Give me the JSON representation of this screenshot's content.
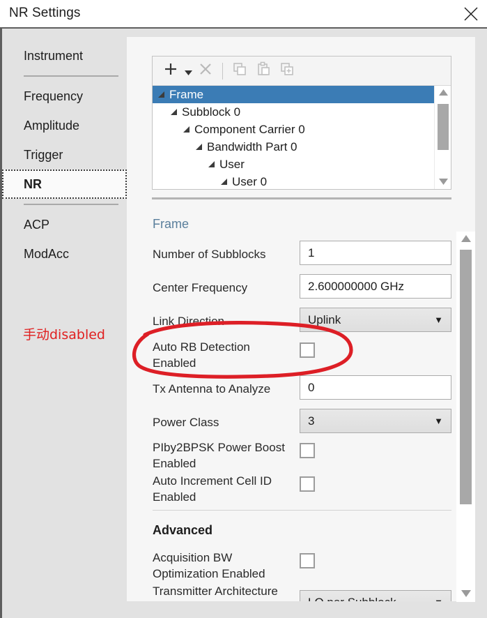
{
  "window": {
    "title": "NR Settings",
    "close_icon": "close-icon"
  },
  "sidebar": {
    "items": [
      {
        "label": "Instrument",
        "selected": false
      },
      {
        "label": "Frequency",
        "selected": false
      },
      {
        "label": "Amplitude",
        "selected": false
      },
      {
        "label": "Trigger",
        "selected": false
      },
      {
        "label": "NR",
        "selected": true
      },
      {
        "label": "ACP",
        "selected": false
      },
      {
        "label": "ModAcc",
        "selected": false
      }
    ],
    "annotation": "手动disabled",
    "annotation_color": "#e02020"
  },
  "toolbar": {
    "add_label": "+",
    "add_dropdown_label": "▾",
    "delete_label": "✕",
    "icons": [
      "add-icon",
      "add-dropdown-caret-icon",
      "delete-icon",
      "copy-icon",
      "paste-icon",
      "duplicate-icon"
    ]
  },
  "tree": {
    "nodes": [
      {
        "label": "Frame",
        "depth": 0,
        "selected": true
      },
      {
        "label": "Subblock 0",
        "depth": 1,
        "selected": false
      },
      {
        "label": "Component Carrier 0",
        "depth": 2,
        "selected": false
      },
      {
        "label": "Bandwidth Part 0",
        "depth": 3,
        "selected": false
      },
      {
        "label": "User",
        "depth": 4,
        "selected": false
      },
      {
        "label": "User 0",
        "depth": 5,
        "selected": false
      }
    ],
    "selection_color": "#3b7cb5"
  },
  "form": {
    "section_frame": "Frame",
    "section_advanced": "Advanced",
    "rows": [
      {
        "label": "Number of Subblocks",
        "type": "text",
        "value": "1"
      },
      {
        "label": "Center Frequency",
        "type": "text",
        "value": "2.600000000 GHz"
      },
      {
        "label": "Link Direction",
        "type": "select",
        "value": "Uplink"
      },
      {
        "label": "Auto RB Detection Enabled",
        "type": "checkbox",
        "value": "unchecked"
      },
      {
        "label": "Tx Antenna to Analyze",
        "type": "text",
        "value": "0"
      },
      {
        "label": "Power Class",
        "type": "select",
        "value": "3"
      },
      {
        "label": "PIby2BPSK Power Boost Enabled",
        "type": "checkbox",
        "value": "unchecked"
      },
      {
        "label": "Auto Increment Cell ID Enabled",
        "type": "checkbox",
        "value": "unchecked"
      },
      {
        "label": "Acquisition BW Optimization Enabled",
        "type": "checkbox",
        "value": "unchecked"
      },
      {
        "label": "Transmitter Architecture",
        "type": "select",
        "value": "LO per Subblock"
      }
    ]
  },
  "highlight": {
    "shape": "ellipse",
    "color": "#dd1f26",
    "target": "Auto RB Detection Enabled"
  }
}
